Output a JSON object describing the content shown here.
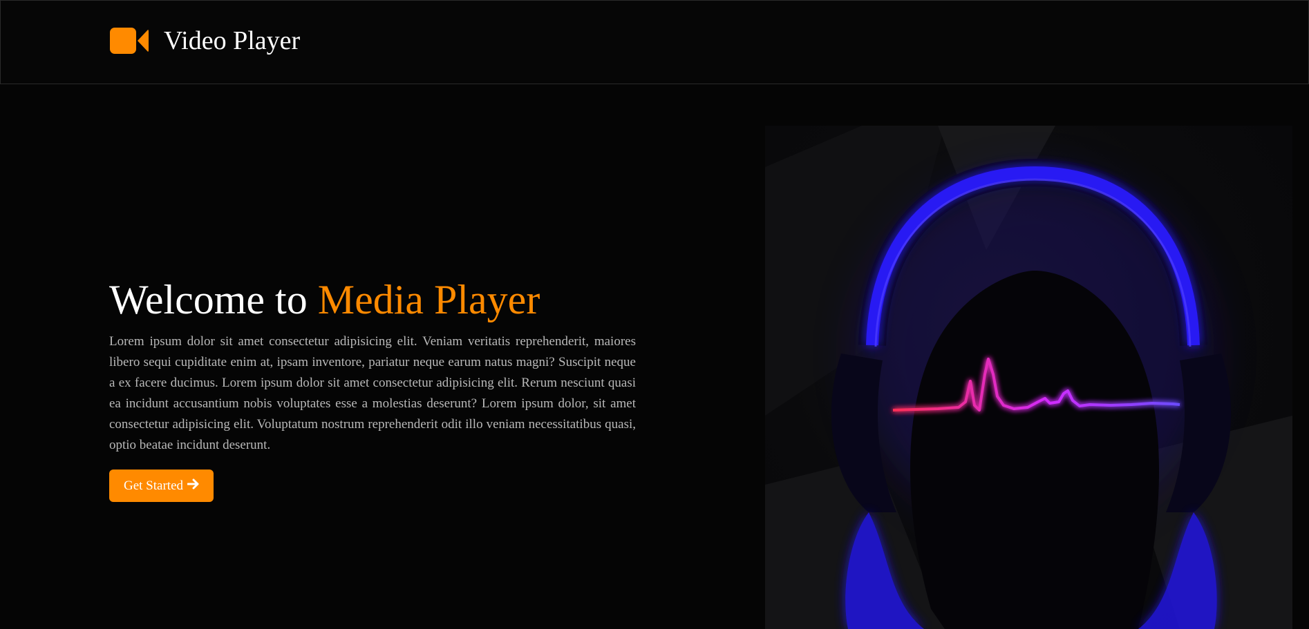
{
  "navbar": {
    "brand_icon": "video-camera-icon",
    "brand_title": "Video Player",
    "brand_color": "#ff8a00"
  },
  "hero": {
    "heading_prefix": "Welcome to ",
    "heading_accent": "Media Player",
    "accent_color": "#ff8a00",
    "paragraph": "Lorem ipsum dolor sit amet consectetur adipisicing elit. Veniam veritatis reprehenderit, maiores libero sequi cupiditate enim at, ipsam inventore, pariatur neque earum natus magni? Suscipit neque a ex facere ducimus. Lorem ipsum dolor sit amet consectetur adipisicing elit. Rerum nesciunt quasi ea incidunt accusantium nobis voluptates esse a molestias deserunt? Lorem ipsum dolor, sit amet consectetur adipisicing elit. Voluptatum nostrum reprehenderit odit illo veniam necessitatibus quasi, optio beatae incidunt deserunt.",
    "cta_label": "Get Started",
    "cta_icon": "arrow-right-icon"
  },
  "image": {
    "subject": "neon-headphones-heartbeat",
    "headphone_color": "#2a1cff",
    "wave_colors": [
      "#ff2d55",
      "#c02cff",
      "#6a4cff"
    ]
  }
}
